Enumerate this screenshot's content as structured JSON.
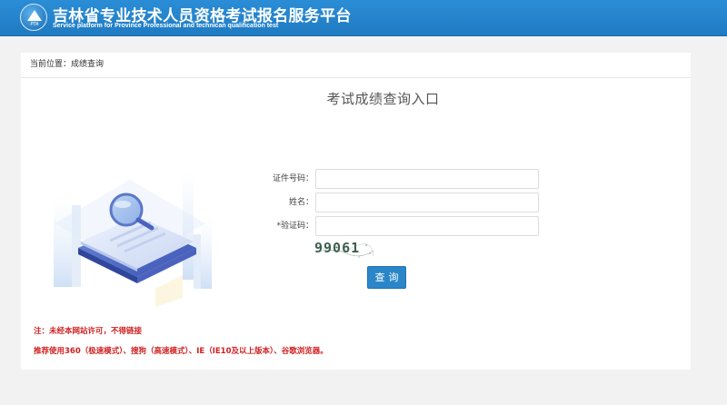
{
  "header": {
    "logo_text": "PTA",
    "title": "吉林省专业技术人员资格考试报名服务平台",
    "subtitle": "Service platform for Province Professional and technican qualification test"
  },
  "breadcrumb": {
    "text": "当前位置：成绩查询"
  },
  "main": {
    "title": "考试成绩查询入口",
    "form": {
      "id_label": "证件号码：",
      "id_value": "",
      "name_label": "姓名：",
      "name_value": "",
      "captcha_label": "*验证码：",
      "captcha_value": "",
      "captcha_image_text": "99061",
      "submit_label": "查询"
    },
    "notes": {
      "line1": "注：未经本网站许可，不得链接",
      "line2": "推荐使用360（极速模式）、搜狗（高速模式）、IE（IE10及以上版本）、谷歌浏览器。"
    }
  },
  "colors": {
    "header_bg": "#1f7bc2",
    "button_bg": "#2a86c8",
    "note_red": "#d02020",
    "page_bg": "#f2f2f2"
  }
}
